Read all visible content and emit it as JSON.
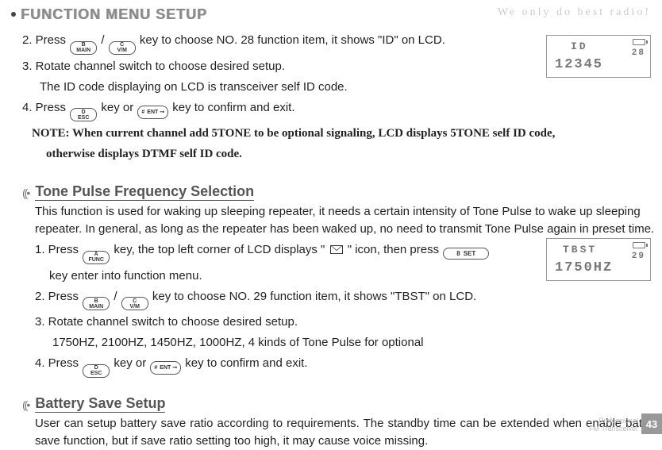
{
  "header": {
    "title": "FUNCTION MENU SETUP",
    "slogan": "We only do best radio!"
  },
  "lcd1": {
    "line1": "ID",
    "num": "28",
    "line2": "12345"
  },
  "lcd2": {
    "line1": "TBST",
    "num": "29",
    "line2": "1750HZ"
  },
  "buttons": {
    "b_main_top": "B",
    "b_main_bot": "MAIN",
    "c_vm_top": "C",
    "c_vm_bot": "V/M",
    "d_esc_top": "D",
    "d_esc_bot": "ESC",
    "hash_ent_left": "#",
    "hash_ent_right": "ENT ⊸",
    "a_func_top": "A",
    "a_func_bot": "FUNC",
    "eight_set_left": "8",
    "eight_set_right": "SET"
  },
  "block1": {
    "s2_a": "2. Press ",
    "s2_slash": "/",
    "s2_b": "key to choose NO. 28 function item, it shows \"ID\" on LCD.",
    "s3": "3. Rotate channel switch to choose desired setup.",
    "s3_note": "The ID code displaying on LCD is transceiver self ID code.",
    "s4_a": "4. Press ",
    "s4_mid": " key or ",
    "s4_b": " key to confirm and exit.",
    "note1": "NOTE: When current channel add 5TONE to be optional signaling, LCD displays 5TONE self ID code,",
    "note2": "otherwise displays DTMF self ID code."
  },
  "tone": {
    "heading": "Tone Pulse Frequency Selection",
    "p1": "This function is used for waking up sleeping repeater, it needs a certain intensity of Tone Pulse to wake up sleeping repeater. In general, as long as the repeater has been waked up, no need to transmit Tone Pulse again in preset time.",
    "s1_a": "1. Press ",
    "s1_b": " key, the top left corner of LCD displays \"",
    "s1_c": "\" icon, then press ",
    "s1_d": "key enter into function menu.",
    "s2_a": "2. Press ",
    "s2_slash": "/",
    "s2_b": " key to choose NO. 29 function item, it shows \"TBST\" on LCD.",
    "s3": "3. Rotate channel switch to choose desired setup.",
    "s3_note": "1750HZ, 2100HZ, 1450HZ, 1000HZ, 4 kinds of Tone Pulse for optional",
    "s4_a": "4. Press ",
    "s4_mid": " key or ",
    "s4_b": " key to confirm and exit."
  },
  "battery": {
    "heading": "Battery Save Setup",
    "p1": "User can setup battery save ratio according to requirements. The standby time can be extended when enable battery save function, but if save ratio setting too high, it may cause voice missing."
  },
  "footer": {
    "line1": "Professional",
    "line2": "FM Transceiver",
    "page": "43"
  }
}
